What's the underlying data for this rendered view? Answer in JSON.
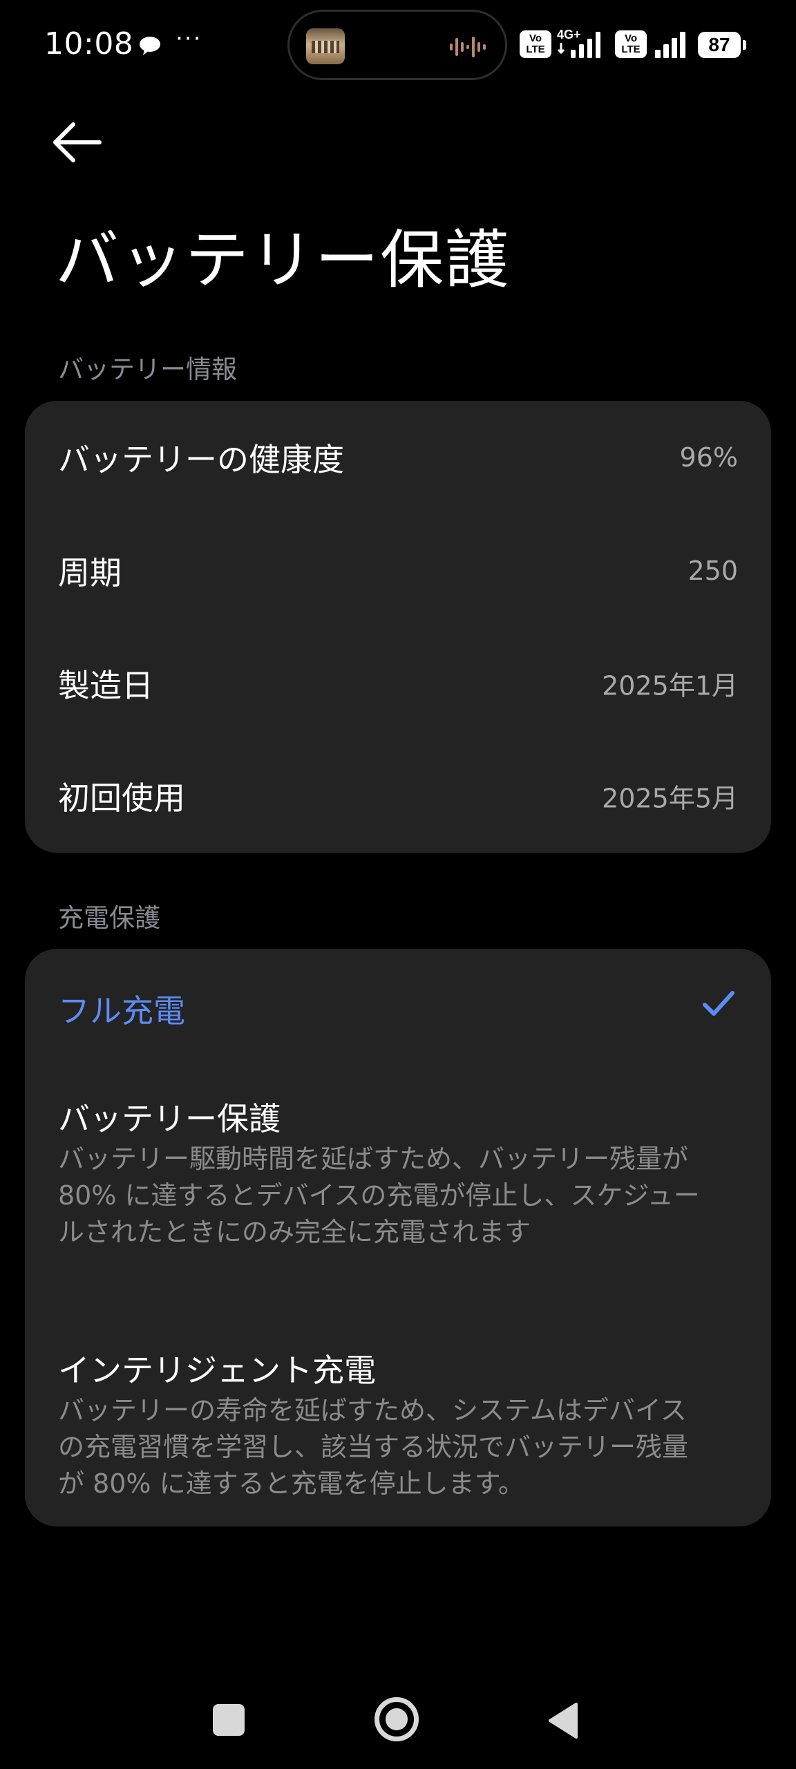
{
  "status_bar": {
    "time": "10:08",
    "more_indicator": "···",
    "volte_label_1": "Vo LTE",
    "network_type": "4G+",
    "volte_label_2": "Vo LTE",
    "battery_level": "87",
    "icons": [
      "chat-bubble-icon",
      "media-thumbnail",
      "audio-wave-icon",
      "signal-icon",
      "battery-icon"
    ]
  },
  "header": {
    "back_icon": "arrow-left-icon",
    "title": "バッテリー保護"
  },
  "battery_info": {
    "section_title": "バッテリー情報",
    "rows": [
      {
        "label": "バッテリーの健康度",
        "value": "96%"
      },
      {
        "label": "周期",
        "value": "250"
      },
      {
        "label": "製造日",
        "value": "2025年1月"
      },
      {
        "label": "初回使用",
        "value": "2025年5月"
      }
    ]
  },
  "charging_protection": {
    "section_title": "充電保護",
    "options": [
      {
        "title": "フル充電",
        "description": "",
        "selected": true
      },
      {
        "title": "バッテリー保護",
        "description": "バッテリー駆動時間を延ばすため、バッテリー残量が 80% に達するとデバイスの充電が停止し、スケジュールされたときにのみ完全に充電されます",
        "selected": false
      },
      {
        "title": "インテリジェント充電",
        "description": "バッテリーの寿命を延ばすため、システムはデバイスの充電習慣を学習し、該当する状況でバッテリー残量が 80% に達すると充電を停止します。",
        "selected": false
      }
    ]
  },
  "nav_bar": {
    "icons": [
      "recents-square-icon",
      "home-circle-icon",
      "back-triangle-icon"
    ]
  },
  "colors": {
    "background": "#000000",
    "card": "#232323",
    "accent": "#5d8bf4",
    "secondary_text": "#8b8b8b"
  }
}
